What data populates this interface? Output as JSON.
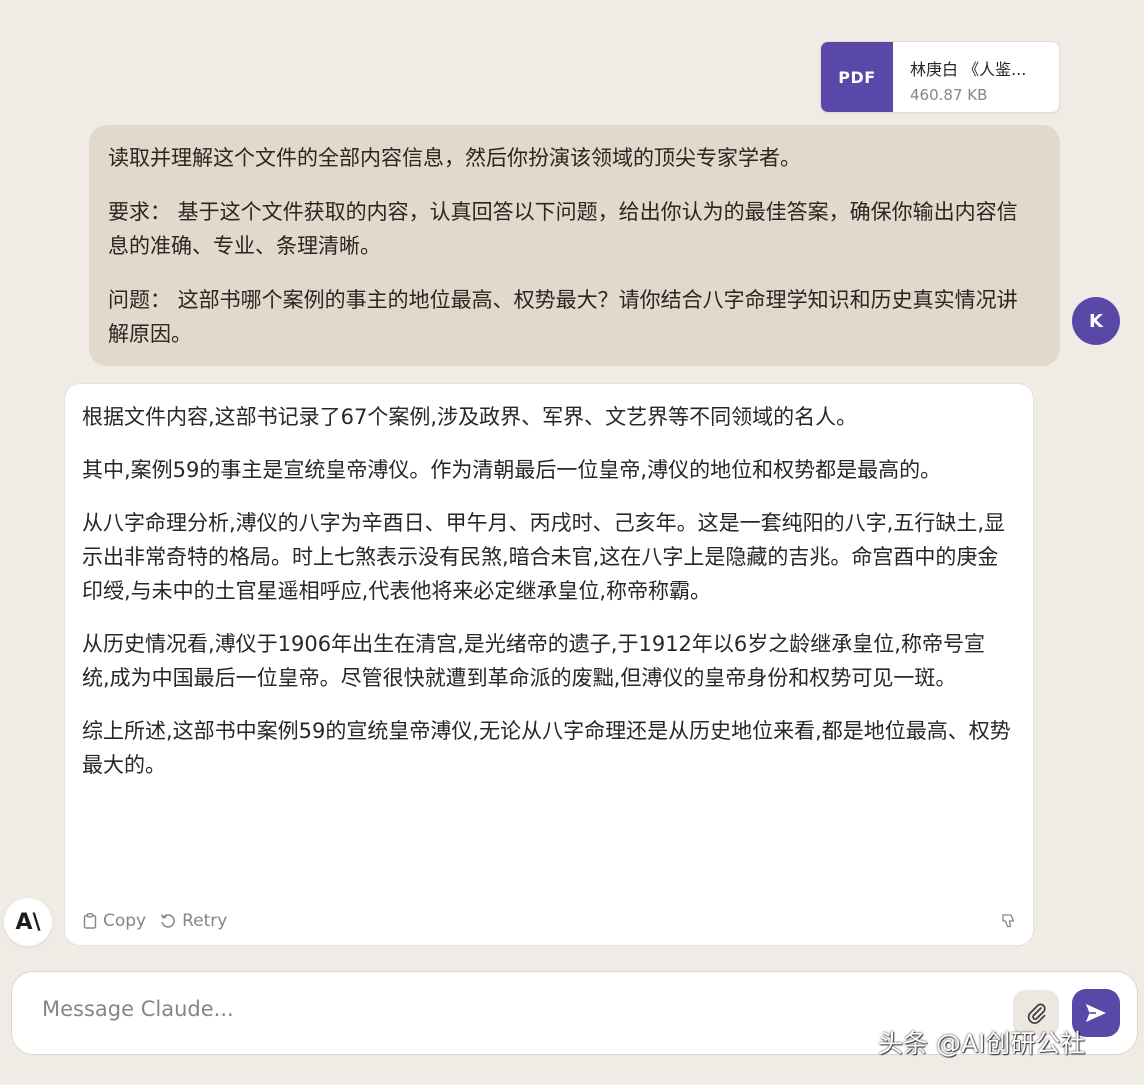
{
  "attachment": {
    "type_label": "PDF",
    "file_name": "林庚白 《人鉴...",
    "file_size": "460.87 KB"
  },
  "user_message": {
    "paragraphs": [
      "读取并理解这个文件的全部内容信息，然后你扮演该领域的顶尖专家学者。",
      "要求： 基于这个文件获取的内容，认真回答以下问题，给出你认为的最佳答案，确保你输出内容信息的准确、专业、条理清晰。",
      "问题： 这部书哪个案例的事主的地位最高、权势最大？请你结合八字命理学知识和历史真实情况讲解原因。"
    ],
    "avatar_initial": "K"
  },
  "assistant_message": {
    "paragraphs": [
      "根据文件内容,这部书记录了67个案例,涉及政界、军界、文艺界等不同领域的名人。",
      "其中,案例59的事主是宣统皇帝溥仪。作为清朝最后一位皇帝,溥仪的地位和权势都是最高的。",
      "从八字命理分析,溥仪的八字为辛酉日、甲午月、丙戌时、己亥年。这是一套纯阳的八字,五行缺土,显示出非常奇特的格局。时上七煞表示没有民煞,暗合未官,这在八字上是隐藏的吉兆。命宫酉中的庚金印绶,与未中的土官星遥相呼应,代表他将来必定继承皇位,称帝称霸。",
      "从历史情况看,溥仪于1906年出生在清宫,是光绪帝的遗子,于1912年以6岁之龄继承皇位,称帝号宣统,成为中国最后一位皇帝。尽管很快就遭到革命派的废黜,但溥仪的皇帝身份和权势可见一斑。",
      "综上所述,这部书中案例59的宣统皇帝溥仪,无论从八字命理还是从历史地位来看,都是地位最高、权势最大的。"
    ],
    "actions": {
      "copy_label": "Copy",
      "retry_label": "Retry"
    },
    "logo_text": "A\\"
  },
  "composer": {
    "placeholder": "Message Claude..."
  },
  "watermark": "头条 @AI创研公社",
  "colors": {
    "accent": "#5a48a8",
    "background": "#f0ebe5",
    "user_bubble": "#e2d8cb"
  },
  "icons": {
    "attach": "paperclip-icon",
    "send": "send-arrow-icon",
    "copy": "clipboard-icon",
    "retry": "retry-icon",
    "feedback": "thumbs-down-icon"
  }
}
